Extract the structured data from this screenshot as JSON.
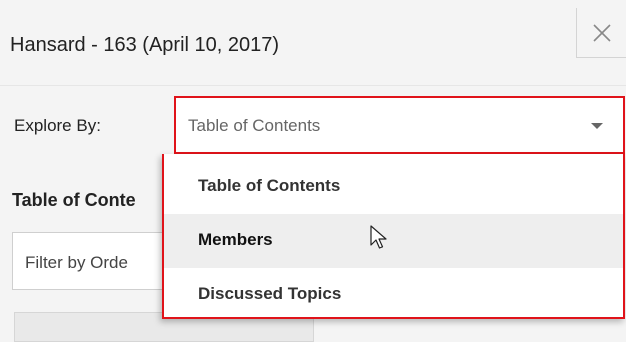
{
  "header": {
    "title": "Hansard - 163 (April 10, 2017)"
  },
  "explore": {
    "label": "Explore By:",
    "selected": "Table of Contents",
    "options": [
      "Table of Contents",
      "Members",
      "Discussed Topics"
    ],
    "hovered_option": "Members"
  },
  "toc": {
    "heading": "Table of Conte"
  },
  "filter": {
    "placeholder": "Filter by Orde"
  },
  "colors": {
    "accent_red": "#e0131a",
    "panel_bg": "#f4f4f4"
  },
  "icons": {
    "close": "close-icon",
    "dropdown": "chevron-down-icon",
    "cursor": "mouse-pointer-icon"
  }
}
